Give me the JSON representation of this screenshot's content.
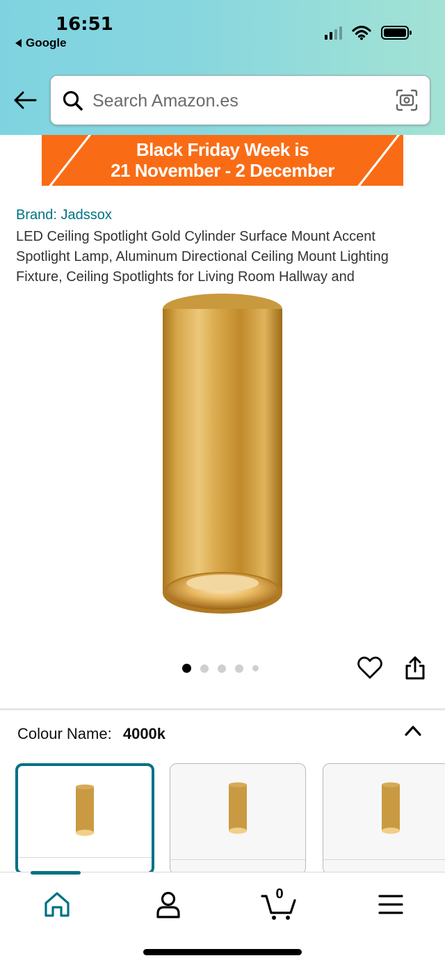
{
  "status_bar": {
    "time": "16:51",
    "back_app": "Google"
  },
  "search": {
    "placeholder": "Search Amazon.es"
  },
  "banner": {
    "line1": "Black Friday Week is",
    "line2": "21 November - 2 December",
    "color": "#f96c15"
  },
  "product": {
    "brand": "Brand: Jadssox",
    "title": "LED Ceiling Spotlight Gold Cylinder Surface Mount Accent Spotlight Lamp, Aluminum Directional Ceiling Mount Lighting Fixture, Ceiling Spotlights for Living Room Hallway and"
  },
  "gallery": {
    "image_count": 5,
    "active_index": 0
  },
  "variation": {
    "label": "Colour Name:",
    "value": "4000k",
    "swatches": [
      "4000k",
      "option-2",
      "option-3"
    ]
  },
  "cart": {
    "count": "0"
  },
  "nav": {
    "items": [
      "home-icon",
      "account-icon",
      "cart-icon",
      "menu-icon"
    ],
    "active": "home"
  },
  "colors": {
    "accent": "#007185",
    "header_gradient_start": "#7fd3e0",
    "header_gradient_end": "#a3e2d4"
  }
}
